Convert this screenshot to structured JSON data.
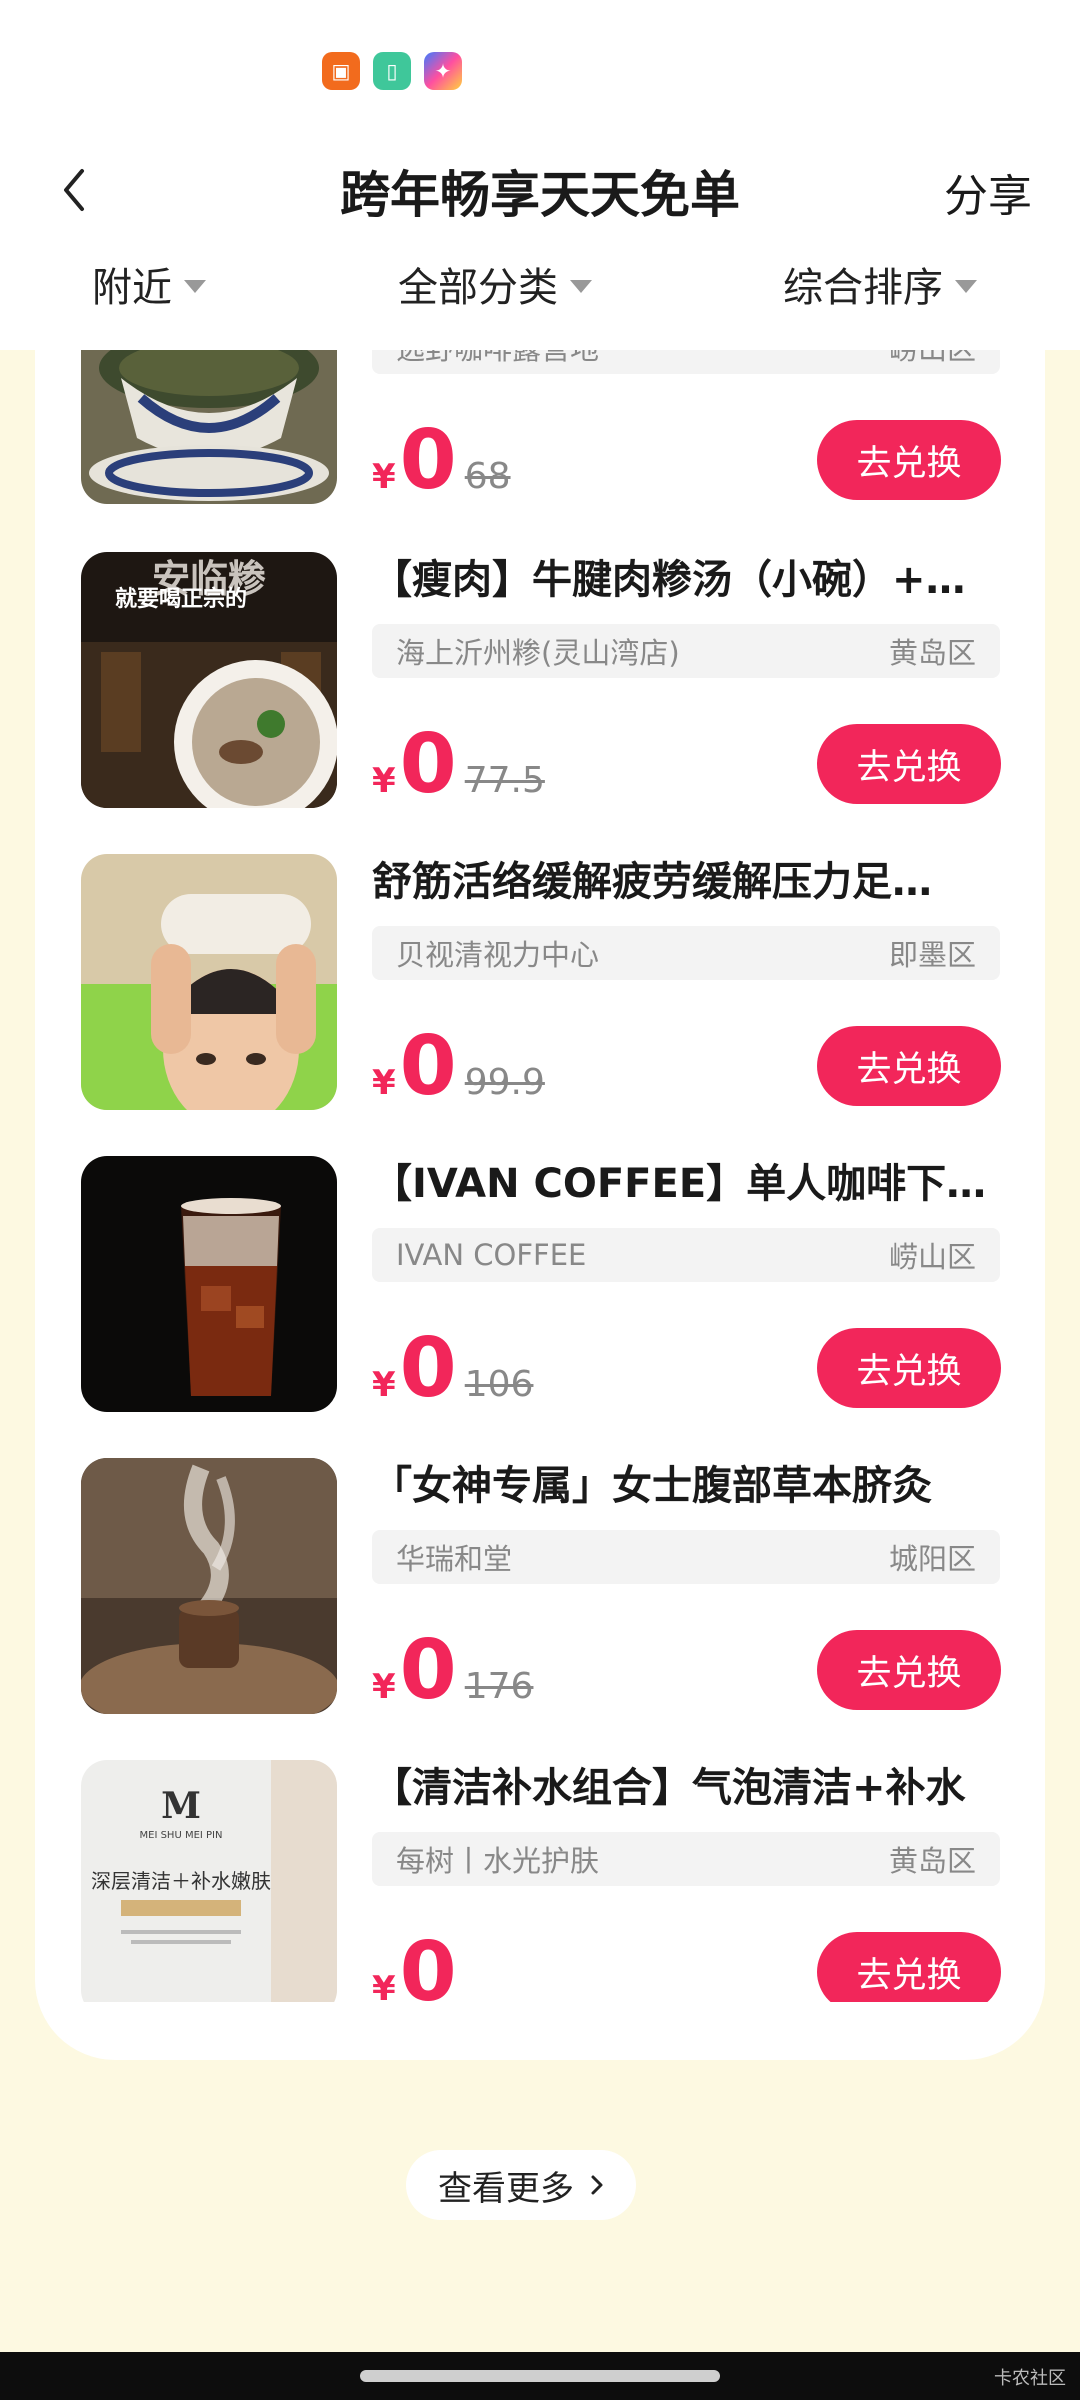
{
  "header": {
    "title": "跨年畅享天天免单",
    "share_label": "分享",
    "filters": [
      "附近",
      "全部分类",
      "综合排序"
    ]
  },
  "currency": "¥",
  "action_label": "去兑换",
  "items": [
    {
      "title": "",
      "store": "逃野咖啡露营地",
      "district": "崂山区",
      "price": "0",
      "original": "68"
    },
    {
      "title": "【瘦肉】牛腱肉糁汤（小碗）+…",
      "store": "海上沂州糁(灵山湾店)",
      "district": "黄岛区",
      "price": "0",
      "original": "77.5",
      "image_text_1": "安临糁",
      "image_text_2": "就要喝正宗的"
    },
    {
      "title": "舒筋活络缓解疲劳缓解压力足…",
      "store": "贝视清视力中心",
      "district": "即墨区",
      "price": "0",
      "original": "99.9"
    },
    {
      "title": "【IVAN COFFEE】单人咖啡下…",
      "store": "IVAN COFFEE",
      "district": "崂山区",
      "price": "0",
      "original": "106"
    },
    {
      "title": "「女神专属」女士腹部草本脐灸",
      "store": "华瑞和堂",
      "district": "城阳区",
      "price": "0",
      "original": "176"
    },
    {
      "title": "【清洁补水组合】气泡清洁+补水",
      "store": "每树丨水光护肤",
      "district": "黄岛区",
      "price": "0",
      "original": "",
      "image_text_1": "MEI SHU MEI PIN",
      "image_text_2": "深层清洁＋补水嫩肤"
    }
  ],
  "view_more_label": "查看更多",
  "watermark": "卡农社区",
  "colors": {
    "accent": "#f2265a",
    "page_bg": "#fdf9e1"
  }
}
